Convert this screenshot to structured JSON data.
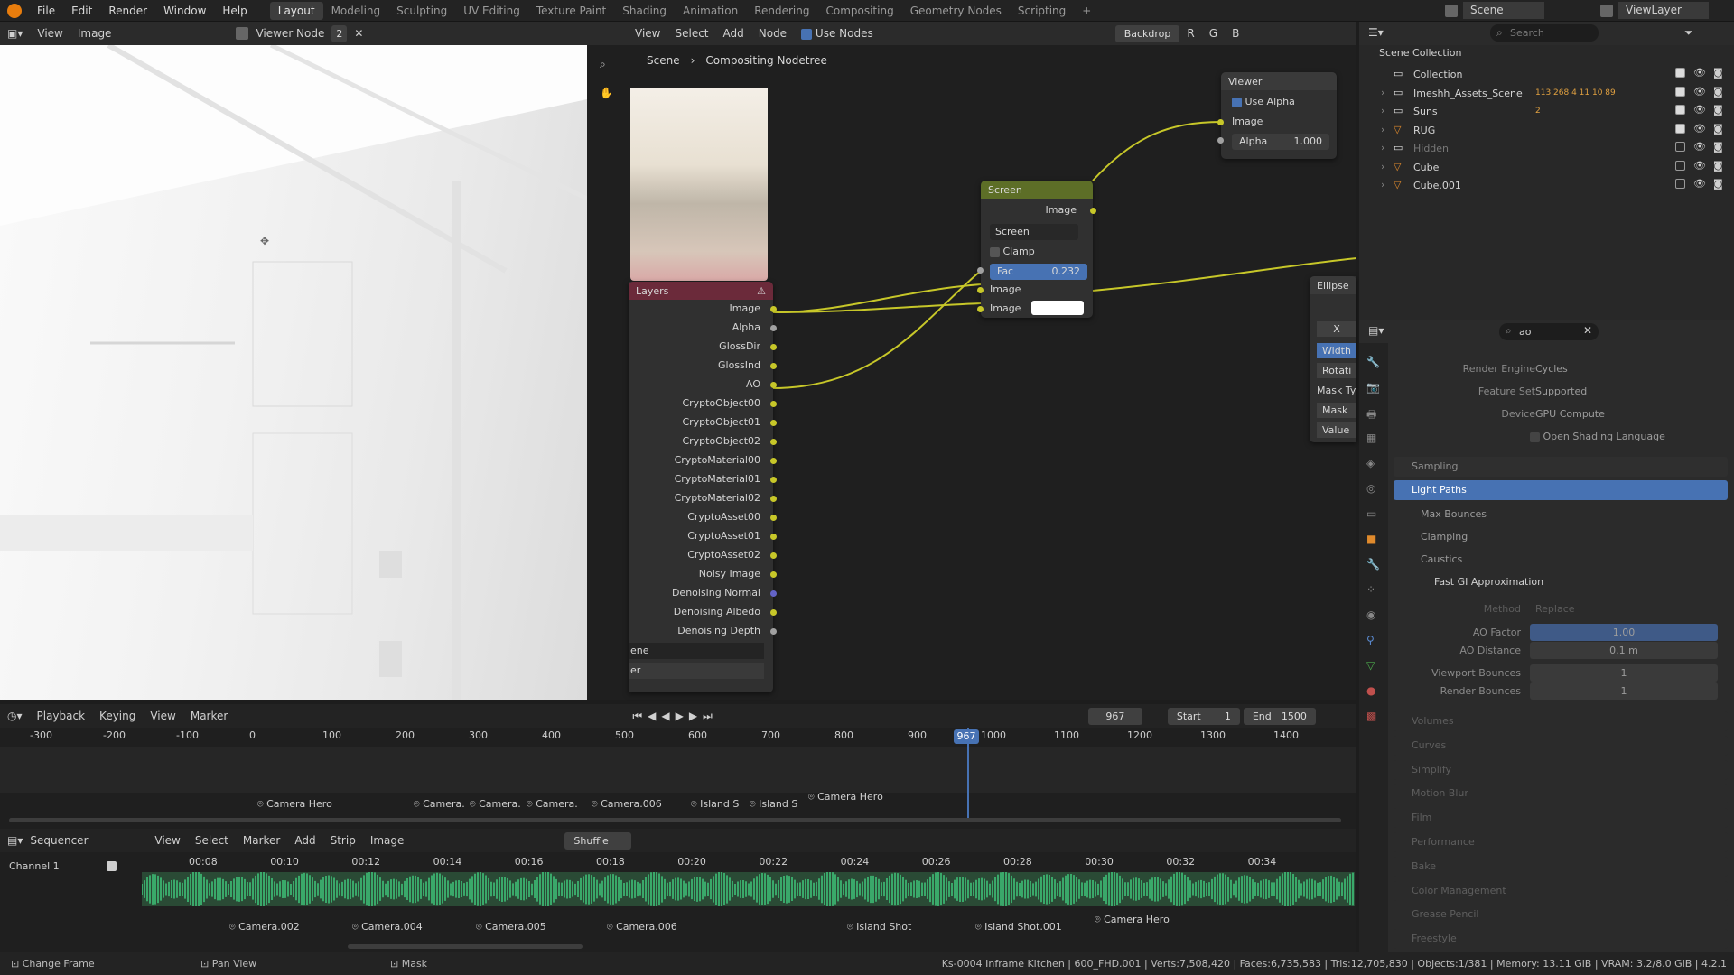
{
  "topbar": {
    "menus": [
      "File",
      "Edit",
      "Render",
      "Window",
      "Help"
    ],
    "workspaces": [
      "Layout",
      "Modeling",
      "Sculpting",
      "UV Editing",
      "Texture Paint",
      "Shading",
      "Animation",
      "Rendering",
      "Compositing",
      "Geometry Nodes",
      "Scripting"
    ],
    "active_workspace": "Layout",
    "scene": "Scene",
    "view_layer": "ViewLayer"
  },
  "image_editor": {
    "menus": [
      "View",
      "Image"
    ],
    "image_name": "Viewer Node",
    "slot": "2"
  },
  "node_editor": {
    "menus": [
      "View",
      "Select",
      "Add",
      "Node"
    ],
    "use_nodes_label": "Use Nodes",
    "backdrop_label": "Backdrop",
    "channels": [
      "R",
      "G",
      "B"
    ],
    "breadcrumb": [
      "Scene",
      "Compositing Nodetree"
    ],
    "viewer": {
      "title": "Viewer",
      "use_alpha": "Use Alpha",
      "image": "Image",
      "alpha_label": "Alpha",
      "alpha_value": "1.000"
    },
    "mix": {
      "title": "Screen",
      "output": "Image",
      "mode": "Screen",
      "clamp": "Clamp",
      "fac_label": "Fac",
      "fac_value": "0.232",
      "in1": "Image",
      "in2": "Image"
    },
    "layers": {
      "title": "Layers",
      "outputs": [
        "Image",
        "Alpha",
        "GlossDir",
        "GlossInd",
        "AO",
        "CryptoObject00",
        "CryptoObject01",
        "CryptoObject02",
        "CryptoMaterial00",
        "CryptoMaterial01",
        "CryptoMaterial02",
        "CryptoAsset00",
        "CryptoAsset01",
        "CryptoAsset02",
        "Noisy Image",
        "Denoising Normal",
        "Denoising Albedo",
        "Denoising Depth"
      ],
      "scene_field": "ene",
      "layer_field": "er"
    },
    "ellipse": {
      "title": "Ellipse",
      "x": "X",
      "width": "Width",
      "rotation": "Rotati",
      "mask_type": "Mask Ty",
      "mask": "Mask",
      "value": "Value"
    }
  },
  "outliner": {
    "search_placeholder": "Search",
    "root": "Scene Collection",
    "items": [
      {
        "label": "Collection"
      },
      {
        "label": "Imeshh_Assets_Scene",
        "extra": "113 268 4 11 10 89"
      },
      {
        "label": "Suns",
        "extra": "2"
      },
      {
        "label": "RUG"
      },
      {
        "label": "Hidden"
      },
      {
        "label": "Cube"
      },
      {
        "label": "Cube.001"
      }
    ]
  },
  "properties": {
    "search_value": "ao",
    "render_engine_label": "Render Engine",
    "render_engine": "Cycles",
    "feature_set_label": "Feature Set",
    "feature_set": "Supported",
    "device_label": "Device",
    "device": "GPU Compute",
    "osl": "Open Shading Language",
    "sections": [
      "Sampling",
      "Light Paths",
      "Max Bounces",
      "Clamping",
      "Caustics",
      "Fast GI Approximation"
    ],
    "method_label": "Method",
    "method": "Replace",
    "ao_factor_label": "AO Factor",
    "ao_factor": "1.00",
    "ao_distance_label": "AO Distance",
    "ao_distance": "0.1 m",
    "viewport_bounces_label": "Viewport Bounces",
    "viewport_bounces": "1",
    "render_bounces_label": "Render Bounces",
    "render_bounces": "1",
    "lower_sections": [
      "Volumes",
      "Curves",
      "Simplify",
      "Motion Blur",
      "Film",
      "Performance",
      "Bake",
      "Color Management",
      "Grease Pencil",
      "Freestyle"
    ]
  },
  "timeline": {
    "menus": [
      "Playback",
      "Keying",
      "View",
      "Marker"
    ],
    "current_frame": "967",
    "start_label": "Start",
    "start": "1",
    "end_label": "End",
    "end": "1500",
    "ruler": [
      "-300",
      "-200",
      "-100",
      "0",
      "100",
      "200",
      "300",
      "400",
      "500",
      "600",
      "700",
      "800",
      "900",
      "1000",
      "1100",
      "1200",
      "1300",
      "1400"
    ],
    "markers": [
      "Camera Hero",
      "Camera.",
      "Camera.",
      "Camera.",
      "Camera.006",
      "Island S",
      "Island S",
      "Camera Hero"
    ]
  },
  "sequencer": {
    "editor": "Sequencer",
    "menus": [
      "View",
      "Select",
      "Marker",
      "Add",
      "Strip",
      "Image"
    ],
    "shuffle": "Shuffle",
    "channel": "Channel 1",
    "times": [
      "00:08",
      "00:10",
      "00:12",
      "00:14",
      "00:16",
      "00:18",
      "00:20",
      "00:22",
      "00:24",
      "00:26",
      "00:28",
      "00:30",
      "00:32",
      "00:34"
    ],
    "markers": [
      "Camera.002",
      "Camera.004",
      "Camera.005",
      "Camera.006",
      "Island Shot",
      "Island Shot.001",
      "Camera Hero"
    ]
  },
  "status": {
    "left": [
      "Change Frame",
      "Pan View",
      "Mask"
    ],
    "right": "Ks-0004 Inframe Kitchen | 600_FHD.001 | Verts:7,508,420 | Faces:6,735,583 | Tris:12,705,830 | Objects:1/381 | Memory: 13.11 GiB | VRAM: 3.2/8.0 GiB | 4.2.1"
  },
  "colors": {
    "selected": "#4772b3",
    "socket_yellow": "#c7c729",
    "socket_gray": "#a1a1a1",
    "socket_purple": "#6363c7",
    "waveform": "#3aa86a"
  }
}
